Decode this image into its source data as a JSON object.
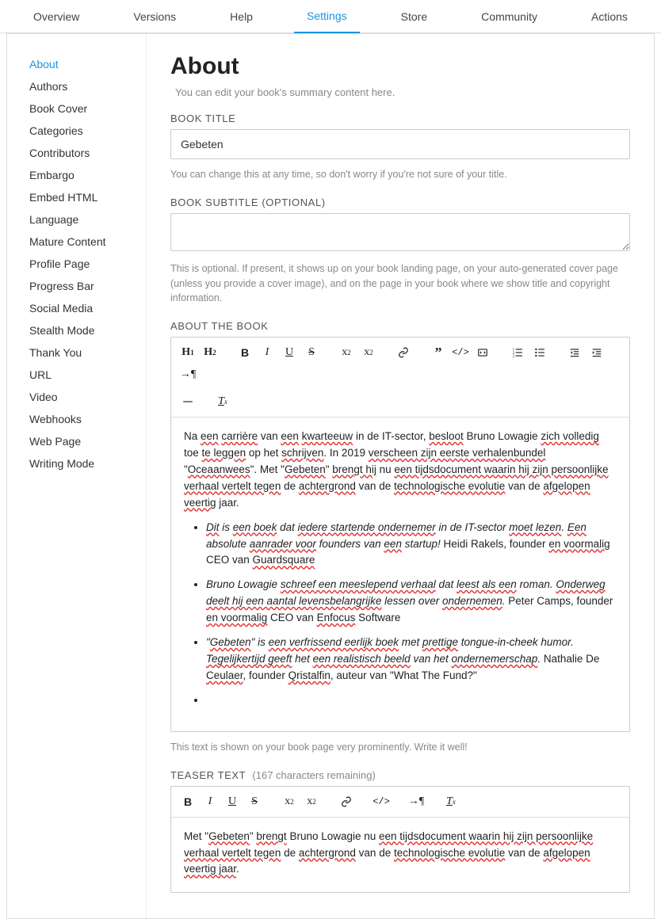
{
  "topnav": {
    "items": [
      "Overview",
      "Versions",
      "Help",
      "Settings",
      "Store",
      "Community",
      "Actions"
    ],
    "activeIndex": 3
  },
  "sidebar": {
    "items": [
      "About",
      "Authors",
      "Book Cover",
      "Categories",
      "Contributors",
      "Embargo",
      "Embed HTML",
      "Language",
      "Mature Content",
      "Profile Page",
      "Progress Bar",
      "Social Media",
      "Stealth Mode",
      "Thank You",
      "URL",
      "Video",
      "Webhooks",
      "Web Page",
      "Writing Mode"
    ],
    "activeIndex": 0
  },
  "page": {
    "heading": "About",
    "intro": "You can edit your book's summary content here."
  },
  "bookTitle": {
    "label": "BOOK TITLE",
    "value": "Gebeten",
    "help": "You can change this at any time, so don't worry if you're not sure of your title."
  },
  "bookSubtitle": {
    "label": "BOOK SUBTITLE (OPTIONAL)",
    "value": "",
    "help": "This is optional. If present, it shows up on your book landing page, on your auto-generated cover page (unless you provide a cover image), and on the page in your book where we show title and copyright information."
  },
  "aboutBook": {
    "label": "ABOUT THE BOOK",
    "paragraph_html": "Na <span class='sp'>een</span> <span class='sp'>carrière</span> van <span class='sp'>een</span> <span class='sp'>kwarteeuw</span> in de IT-sector, <span class='sp'>besloot</span> Bruno Lowagie <span class='sp'>zich volledig</span> toe <span class='sp'>te leggen</span> op het <span class='sp'>schrijven</span>. In 2019 <span class='sp'>verscheen zijn eerste verhalenbundel</span> \"<span class='sp'>Oceaanwees</span>\". Met \"<span class='sp'>Gebeten</span>\" <span class='sp'>brengt hij</span> nu <span class='sp'>een tijdsdocument waarin hij zijn persoonlijke verhaal vertelt tegen</span> de <span class='sp'>achtergrond</span> van de <span class='sp'>technologische evolutie</span> van de <span class='sp'>afgelopen veertig</span> jaar.",
    "bullets_html": [
      "<span class='em'><span class='sp'>Dit</span> is <span class='sp'>een boek</span> dat <span class='sp'>iedere startende ondernemer</span> in de IT-sector <span class='sp'>moet lezen</span>. <span class='sp'>Een</span> absolute <span class='sp'>aanrader voor</span> founders van <span class='sp'>een</span> startup!</span> Heidi Rakels, founder <span class='sp'>en voormalig</span> CEO van <span class='sp'>Guardsquare</span>",
      "<span class='em'>Bruno Lowagie <span class='sp'>schreef een meeslepend verhaal</span> dat <span class='sp'>leest als een</span> roman. <span class='sp'>Onderweg deelt hij een aantal levensbelangrijke</span> lessen over <span class='sp'>ondernemen</span>.</span> Peter Camps, founder <span class='sp'>en voormalig</span> CEO van <span class='sp'>Enfocus</span> Software",
      "<span class='em'>\"<span class='sp'>Gebeten</span>\" is <span class='sp'>een verfrissend eerlijk boek</span> met <span class='sp'>prettige</span> tongue-in-cheek humor. <span class='sp'>Tegelijkertijd geeft</span> het <span class='sp'>een realistisch beeld</span> van het <span class='sp'>ondernemerschap</span>.</span> Nathalie De <span class='sp'>Ceulaer</span>, founder <span class='sp'>Qristalfin</span>, auteur van \"What The Fund?\"",
      ""
    ],
    "help": "This text is shown on your book page very prominently. Write it well!"
  },
  "teaser": {
    "label": "TEASER TEXT",
    "remaining": "(167 characters remaining)",
    "body_html": "Met \"<span class='sp'>Gebeten</span>\" <span class='sp'>brengt</span> Bruno Lowagie nu <span class='sp'>een tijdsdocument waarin hij zijn persoonlijke verhaal vertelt tegen</span> de <span class='sp'>achtergrond</span> van de <span class='sp'>technologische evolutie</span> van de <span class='sp'>afgelopen veertig jaar</span>."
  }
}
